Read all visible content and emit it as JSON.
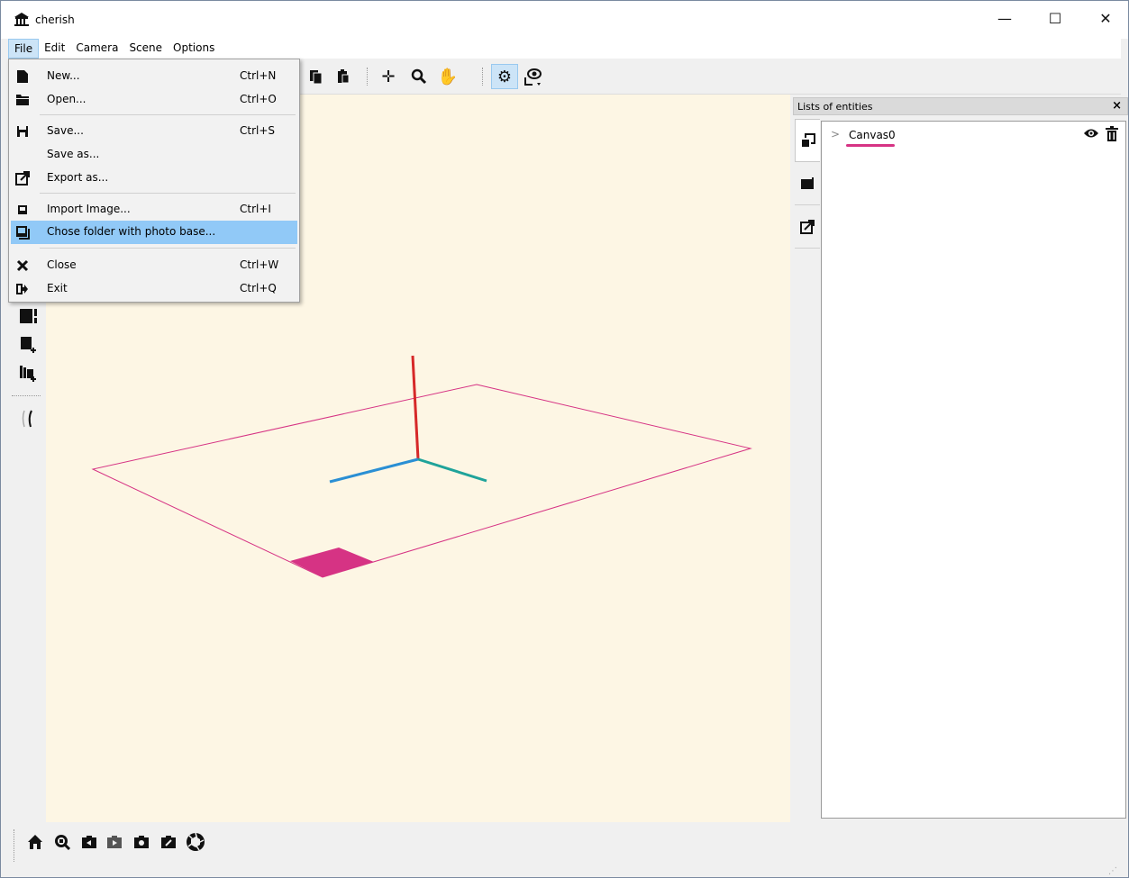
{
  "window": {
    "title": "cherish",
    "minimize_glyph": "—",
    "maximize_glyph": "☐",
    "close_glyph": "✕"
  },
  "menubar": [
    "File",
    "Edit",
    "Camera",
    "Scene",
    "Options"
  ],
  "file_menu": {
    "items": [
      {
        "label": "New...",
        "shortcut": "Ctrl+N",
        "icon": "new-file-icon"
      },
      {
        "label": "Open...",
        "shortcut": "Ctrl+O",
        "icon": "open-folder-icon"
      },
      {
        "label": "Save...",
        "shortcut": "Ctrl+S",
        "icon": "save-icon"
      },
      {
        "label": "Save as...",
        "shortcut": "",
        "icon": ""
      },
      {
        "label": "Export as...",
        "shortcut": "",
        "icon": "export-icon"
      },
      {
        "label": "Import Image...",
        "shortcut": "Ctrl+I",
        "icon": "import-image-icon"
      },
      {
        "label": "Chose folder with photo base...",
        "shortcut": "",
        "icon": "photo-base-icon",
        "highlighted": true
      },
      {
        "label": "Close",
        "shortcut": "Ctrl+W",
        "icon": "close-icon"
      },
      {
        "label": "Exit",
        "shortcut": "Ctrl+Q",
        "icon": "exit-icon"
      }
    ]
  },
  "dock": {
    "title": "Lists of entities",
    "close_glyph": "×",
    "entities": [
      {
        "name": "Canvas0",
        "expand_glyph": ">",
        "eye_glyph": "👁",
        "trash_glyph": "🗑"
      }
    ]
  },
  "colors": {
    "viewport_background": "#fdf6e4",
    "canvas_outline": "#d63384",
    "axis_x": "#2a8fd4",
    "axis_y": "#1fa39a",
    "axis_z": "#d62828",
    "menu_highlight": "#91c9f7"
  }
}
